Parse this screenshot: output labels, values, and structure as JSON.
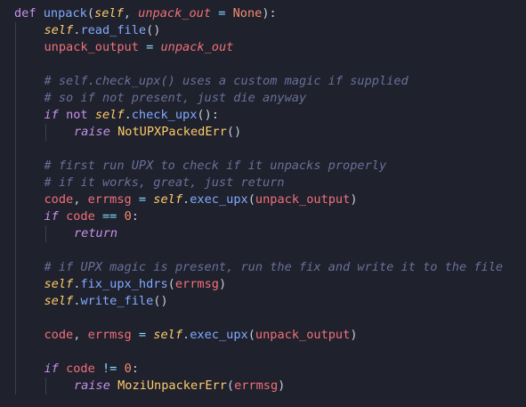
{
  "editor": {
    "language": "python",
    "theme_colors": {
      "background": "#1f212d",
      "keyword": "#c792ea",
      "function": "#82aaff",
      "self": "#ffcb6b",
      "variable": "#f07178",
      "constant": "#f78c6c",
      "operator": "#89ddff",
      "comment": "#697098",
      "punctuation": "#c3ccdc"
    },
    "lines": [
      {
        "indent": 0,
        "tokens": [
          {
            "t": "def",
            "c": "kw"
          },
          {
            "t": " ",
            "c": "plain"
          },
          {
            "t": "unpack",
            "c": "fn"
          },
          {
            "t": "(",
            "c": "punc"
          },
          {
            "t": "self",
            "c": "self"
          },
          {
            "t": ", ",
            "c": "punc"
          },
          {
            "t": "unpack_out",
            "c": "param"
          },
          {
            "t": " = ",
            "c": "op"
          },
          {
            "t": "None",
            "c": "const"
          },
          {
            "t": "):",
            "c": "punc"
          }
        ]
      },
      {
        "indent": 1,
        "tokens": [
          {
            "t": "self",
            "c": "self"
          },
          {
            "t": ".",
            "c": "punc"
          },
          {
            "t": "read_file",
            "c": "fn"
          },
          {
            "t": "()",
            "c": "punc"
          }
        ]
      },
      {
        "indent": 1,
        "tokens": [
          {
            "t": "unpack_output",
            "c": "var"
          },
          {
            "t": " = ",
            "c": "op"
          },
          {
            "t": "unpack_out",
            "c": "param"
          }
        ]
      },
      {
        "indent": 1,
        "tokens": []
      },
      {
        "indent": 1,
        "tokens": [
          {
            "t": "# self.check_upx() uses a custom magic if supplied",
            "c": "com"
          }
        ]
      },
      {
        "indent": 1,
        "tokens": [
          {
            "t": "# so if not present, just die anyway",
            "c": "com"
          }
        ]
      },
      {
        "indent": 1,
        "tokens": [
          {
            "t": "if",
            "c": "kw-ital"
          },
          {
            "t": " ",
            "c": "plain"
          },
          {
            "t": "not",
            "c": "kw"
          },
          {
            "t": " ",
            "c": "plain"
          },
          {
            "t": "self",
            "c": "self"
          },
          {
            "t": ".",
            "c": "punc"
          },
          {
            "t": "check_upx",
            "c": "fn"
          },
          {
            "t": "():",
            "c": "punc"
          }
        ]
      },
      {
        "indent": 2,
        "tokens": [
          {
            "t": "raise",
            "c": "kw-ital"
          },
          {
            "t": " ",
            "c": "plain"
          },
          {
            "t": "NotUPXPackedErr",
            "c": "cls"
          },
          {
            "t": "()",
            "c": "punc"
          }
        ]
      },
      {
        "indent": 1,
        "tokens": []
      },
      {
        "indent": 1,
        "tokens": [
          {
            "t": "# first run UPX to check if it unpacks properly",
            "c": "com"
          }
        ]
      },
      {
        "indent": 1,
        "tokens": [
          {
            "t": "# if it works, great, just return",
            "c": "com"
          }
        ]
      },
      {
        "indent": 1,
        "tokens": [
          {
            "t": "code",
            "c": "var"
          },
          {
            "t": ", ",
            "c": "punc"
          },
          {
            "t": "errmsg",
            "c": "var"
          },
          {
            "t": " = ",
            "c": "op"
          },
          {
            "t": "self",
            "c": "self"
          },
          {
            "t": ".",
            "c": "punc"
          },
          {
            "t": "exec_upx",
            "c": "fn"
          },
          {
            "t": "(",
            "c": "punc"
          },
          {
            "t": "unpack_output",
            "c": "var"
          },
          {
            "t": ")",
            "c": "punc"
          }
        ]
      },
      {
        "indent": 1,
        "tokens": [
          {
            "t": "if",
            "c": "kw-ital"
          },
          {
            "t": " ",
            "c": "plain"
          },
          {
            "t": "code",
            "c": "var"
          },
          {
            "t": " == ",
            "c": "op"
          },
          {
            "t": "0",
            "c": "const"
          },
          {
            "t": ":",
            "c": "punc"
          }
        ]
      },
      {
        "indent": 2,
        "tokens": [
          {
            "t": "return",
            "c": "kw-ital"
          }
        ]
      },
      {
        "indent": 1,
        "tokens": []
      },
      {
        "indent": 1,
        "tokens": [
          {
            "t": "# if UPX magic is present, run the fix and write it to the file",
            "c": "com"
          }
        ]
      },
      {
        "indent": 1,
        "tokens": [
          {
            "t": "self",
            "c": "self"
          },
          {
            "t": ".",
            "c": "punc"
          },
          {
            "t": "fix_upx_hdrs",
            "c": "fn"
          },
          {
            "t": "(",
            "c": "punc"
          },
          {
            "t": "errmsg",
            "c": "var"
          },
          {
            "t": ")",
            "c": "punc"
          }
        ]
      },
      {
        "indent": 1,
        "tokens": [
          {
            "t": "self",
            "c": "self"
          },
          {
            "t": ".",
            "c": "punc"
          },
          {
            "t": "write_file",
            "c": "fn"
          },
          {
            "t": "()",
            "c": "punc"
          }
        ]
      },
      {
        "indent": 1,
        "tokens": []
      },
      {
        "indent": 1,
        "tokens": [
          {
            "t": "code",
            "c": "var"
          },
          {
            "t": ", ",
            "c": "punc"
          },
          {
            "t": "errmsg",
            "c": "var"
          },
          {
            "t": " = ",
            "c": "op"
          },
          {
            "t": "self",
            "c": "self"
          },
          {
            "t": ".",
            "c": "punc"
          },
          {
            "t": "exec_upx",
            "c": "fn"
          },
          {
            "t": "(",
            "c": "punc"
          },
          {
            "t": "unpack_output",
            "c": "var"
          },
          {
            "t": ")",
            "c": "punc"
          }
        ]
      },
      {
        "indent": 1,
        "tokens": []
      },
      {
        "indent": 1,
        "tokens": [
          {
            "t": "if",
            "c": "kw-ital"
          },
          {
            "t": " ",
            "c": "plain"
          },
          {
            "t": "code",
            "c": "var"
          },
          {
            "t": " != ",
            "c": "op"
          },
          {
            "t": "0",
            "c": "const"
          },
          {
            "t": ":",
            "c": "punc"
          }
        ]
      },
      {
        "indent": 2,
        "tokens": [
          {
            "t": "raise",
            "c": "kw-ital"
          },
          {
            "t": " ",
            "c": "plain"
          },
          {
            "t": "MoziUnpackerErr",
            "c": "cls"
          },
          {
            "t": "(",
            "c": "punc"
          },
          {
            "t": "errmsg",
            "c": "var"
          },
          {
            "t": ")",
            "c": "punc"
          }
        ]
      }
    ]
  }
}
